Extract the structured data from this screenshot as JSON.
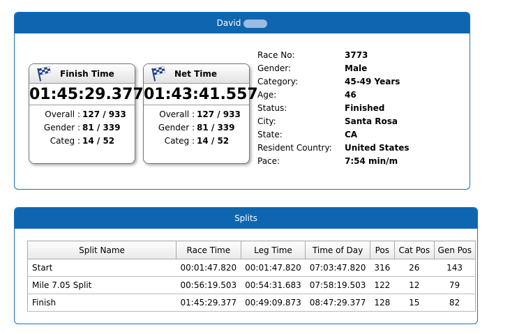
{
  "runner": {
    "first_name": "David",
    "finish_card": {
      "title": "Finish Time",
      "time": "01:45:29.377",
      "overall_label": "Overall :",
      "overall": "127 / 933",
      "gender_label": "Gender :",
      "gender": "81 / 339",
      "categ_label": "Categ :",
      "categ": "14 / 52"
    },
    "net_card": {
      "title": "Net Time",
      "time": "01:43:41.557",
      "overall_label": "Overall :",
      "overall": "127 / 933",
      "gender_label": "Gender :",
      "gender": "81 / 339",
      "categ_label": "Categ :",
      "categ": "14 / 52"
    },
    "info": [
      {
        "key": "Race No:",
        "value": "3773"
      },
      {
        "key": "Gender:",
        "value": "Male"
      },
      {
        "key": "Category:",
        "value": "45-49 Years"
      },
      {
        "key": "Age:",
        "value": "46"
      },
      {
        "key": "Status:",
        "value": "Finished"
      },
      {
        "key": "City:",
        "value": "Santa Rosa"
      },
      {
        "key": "State:",
        "value": "CA"
      },
      {
        "key": "Resident Country:",
        "value": "United States"
      },
      {
        "key": "Pace:",
        "value": "7:54 min/m"
      }
    ]
  },
  "splits": {
    "title": "Splits",
    "columns": [
      "Split Name",
      "Race Time",
      "Leg Time",
      "Time of Day",
      "Pos",
      "Cat Pos",
      "Gen Pos"
    ],
    "rows": [
      [
        "Start",
        "00:01:47.820",
        "00:01:47.820",
        "07:03:47.820",
        "316",
        "26",
        "143"
      ],
      [
        "Mile 7.05 Split",
        "00:56:19.503",
        "00:54:31.683",
        "07:58:19.503",
        "122",
        "12",
        "79"
      ],
      [
        "Finish",
        "01:45:29.377",
        "00:49:09.873",
        "08:47:29.377",
        "128",
        "15",
        "82"
      ]
    ]
  },
  "colors": {
    "header_blue": "#0f66b0",
    "border_blue": "#1f6fb2"
  },
  "icons": {
    "card_icon": "checkered-flag-icon"
  }
}
